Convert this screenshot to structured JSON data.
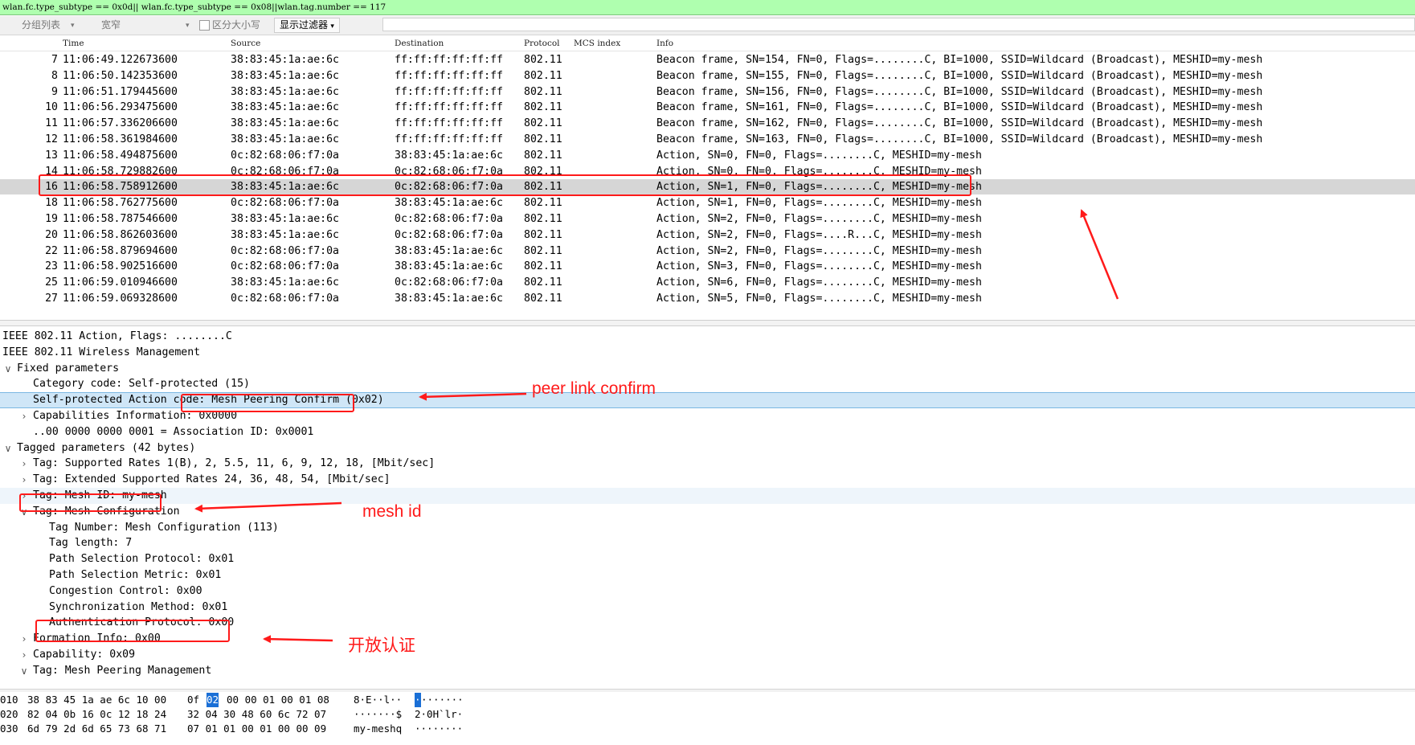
{
  "filter": {
    "text": "wlan.fc.type_subtype == 0x0d|| wlan.fc.type_subtype == 0x08||wlan.tag.number == 117"
  },
  "toolbar": {
    "group_list": "分组列表",
    "width": "宽窄",
    "case_sensitive": "区分大小写",
    "display_filter": "显示过滤器"
  },
  "packet_list": {
    "columns": [
      "Time",
      "Source",
      "Destination",
      "Protocol",
      "MCS index",
      "Info"
    ],
    "rows": [
      {
        "no": "7",
        "time": "11:06:49.122673600",
        "src": "38:83:45:1a:ae:6c",
        "dst": "ff:ff:ff:ff:ff:ff",
        "proto": "802.11",
        "info": "Beacon frame, SN=154, FN=0, Flags=........C, BI=1000, SSID=Wildcard (Broadcast), MESHID=my-mesh"
      },
      {
        "no": "8",
        "time": "11:06:50.142353600",
        "src": "38:83:45:1a:ae:6c",
        "dst": "ff:ff:ff:ff:ff:ff",
        "proto": "802.11",
        "info": "Beacon frame, SN=155, FN=0, Flags=........C, BI=1000, SSID=Wildcard (Broadcast), MESHID=my-mesh"
      },
      {
        "no": "9",
        "time": "11:06:51.179445600",
        "src": "38:83:45:1a:ae:6c",
        "dst": "ff:ff:ff:ff:ff:ff",
        "proto": "802.11",
        "info": "Beacon frame, SN=156, FN=0, Flags=........C, BI=1000, SSID=Wildcard (Broadcast), MESHID=my-mesh"
      },
      {
        "no": "10",
        "time": "11:06:56.293475600",
        "src": "38:83:45:1a:ae:6c",
        "dst": "ff:ff:ff:ff:ff:ff",
        "proto": "802.11",
        "info": "Beacon frame, SN=161, FN=0, Flags=........C, BI=1000, SSID=Wildcard (Broadcast), MESHID=my-mesh"
      },
      {
        "no": "11",
        "time": "11:06:57.336206600",
        "src": "38:83:45:1a:ae:6c",
        "dst": "ff:ff:ff:ff:ff:ff",
        "proto": "802.11",
        "info": "Beacon frame, SN=162, FN=0, Flags=........C, BI=1000, SSID=Wildcard (Broadcast), MESHID=my-mesh"
      },
      {
        "no": "12",
        "time": "11:06:58.361984600",
        "src": "38:83:45:1a:ae:6c",
        "dst": "ff:ff:ff:ff:ff:ff",
        "proto": "802.11",
        "info": "Beacon frame, SN=163, FN=0, Flags=........C, BI=1000, SSID=Wildcard (Broadcast), MESHID=my-mesh"
      },
      {
        "no": "13",
        "time": "11:06:58.494875600",
        "src": "0c:82:68:06:f7:0a",
        "dst": "38:83:45:1a:ae:6c",
        "proto": "802.11",
        "info": "Action, SN=0, FN=0, Flags=........C, MESHID=my-mesh"
      },
      {
        "no": "14",
        "time": "11:06:58.729882600",
        "src": "0c:82:68:06:f7:0a",
        "dst": "0c:82:68:06:f7:0a",
        "proto": "802.11",
        "info": "Action, SN=0, FN=0, Flags=........C, MESHID=my-mesh"
      },
      {
        "no": "16",
        "time": "11:06:58.758912600",
        "src": "38:83:45:1a:ae:6c",
        "dst": "0c:82:68:06:f7:0a",
        "proto": "802.11",
        "info": "Action, SN=1, FN=0, Flags=........C, MESHID=my-mesh"
      },
      {
        "no": "18",
        "time": "11:06:58.762775600",
        "src": "0c:82:68:06:f7:0a",
        "dst": "38:83:45:1a:ae:6c",
        "proto": "802.11",
        "info": "Action, SN=1, FN=0, Flags=........C, MESHID=my-mesh"
      },
      {
        "no": "19",
        "time": "11:06:58.787546600",
        "src": "38:83:45:1a:ae:6c",
        "dst": "0c:82:68:06:f7:0a",
        "proto": "802.11",
        "info": "Action, SN=2, FN=0, Flags=........C, MESHID=my-mesh"
      },
      {
        "no": "20",
        "time": "11:06:58.862603600",
        "src": "38:83:45:1a:ae:6c",
        "dst": "0c:82:68:06:f7:0a",
        "proto": "802.11",
        "info": "Action, SN=2, FN=0, Flags=....R...C, MESHID=my-mesh"
      },
      {
        "no": "22",
        "time": "11:06:58.879694600",
        "src": "0c:82:68:06:f7:0a",
        "dst": "38:83:45:1a:ae:6c",
        "proto": "802.11",
        "info": "Action, SN=2, FN=0, Flags=........C, MESHID=my-mesh"
      },
      {
        "no": "23",
        "time": "11:06:58.902516600",
        "src": "0c:82:68:06:f7:0a",
        "dst": "38:83:45:1a:ae:6c",
        "proto": "802.11",
        "info": "Action, SN=3, FN=0, Flags=........C, MESHID=my-mesh"
      },
      {
        "no": "25",
        "time": "11:06:59.010946600",
        "src": "38:83:45:1a:ae:6c",
        "dst": "0c:82:68:06:f7:0a",
        "proto": "802.11",
        "info": "Action, SN=6, FN=0, Flags=........C, MESHID=my-mesh"
      },
      {
        "no": "27",
        "time": "11:06:59.069328600",
        "src": "0c:82:68:06:f7:0a",
        "dst": "38:83:45:1a:ae:6c",
        "proto": "802.11",
        "info": "Action, SN=5, FN=0, Flags=........C, MESHID=my-mesh"
      }
    ]
  },
  "details": {
    "rows": [
      {
        "toggle": "",
        "text": "IEEE 802.11 Action, Flags: ........C"
      },
      {
        "toggle": "",
        "text": "IEEE 802.11 Wireless Management"
      },
      {
        "toggle": "∨",
        "text": "Fixed parameters"
      },
      {
        "toggle": "",
        "text": "Category code: Self-protected (15)"
      },
      {
        "toggle": "",
        "text": "Self-protected Action code: Mesh Peering Confirm (0x02)"
      },
      {
        "toggle": "›",
        "text": "Capabilities Information: 0x0000"
      },
      {
        "toggle": "",
        "text": "..00 0000 0000 0001 = Association ID: 0x0001"
      },
      {
        "toggle": "∨",
        "text": "Tagged parameters (42 bytes)"
      },
      {
        "toggle": "›",
        "text": "Tag: Supported Rates 1(B), 2, 5.5, 11, 6, 9, 12, 18, [Mbit/sec]"
      },
      {
        "toggle": "›",
        "text": "Tag: Extended Supported Rates 24, 36, 48, 54, [Mbit/sec]"
      },
      {
        "toggle": "›",
        "text": "Tag: Mesh ID: my-mesh"
      },
      {
        "toggle": "∨",
        "text": "Tag: Mesh Configuration"
      },
      {
        "toggle": "",
        "text": "Tag Number: Mesh Configuration (113)"
      },
      {
        "toggle": "",
        "text": "Tag length: 7"
      },
      {
        "toggle": "",
        "text": "Path Selection Protocol: 0x01"
      },
      {
        "toggle": "",
        "text": "Path Selection Metric: 0x01"
      },
      {
        "toggle": "",
        "text": "Congestion Control: 0x00"
      },
      {
        "toggle": "",
        "text": "Synchronization Method: 0x01"
      },
      {
        "toggle": "",
        "text": "Authentication Protocol: 0x00"
      },
      {
        "toggle": "›",
        "text": "Formation Info: 0x00"
      },
      {
        "toggle": "›",
        "text": "Capability: 0x09"
      },
      {
        "toggle": "∨",
        "text": "Tag: Mesh Peering Management"
      }
    ]
  },
  "bytes": {
    "rows": [
      {
        "offset": "010",
        "hex_a": "38 83 45 1a ae 6c 10 00",
        "hex_b1": "0f",
        "hex_sel": "02",
        "hex_b2": "00 00 01 00 01 08",
        "ascii_a": "8·E··l··",
        "ascii_sel": "·",
        "ascii_b": "·······"
      },
      {
        "offset": "020",
        "hex_a": "82 04 0b 16 0c 12 18 24",
        "hex_b1": "32 04 30 48 60 6c 72 07",
        "hex_sel": "",
        "hex_b2": "",
        "ascii_a": "·······$",
        "ascii_sel": "",
        "ascii_b": "2·0H`lr·"
      },
      {
        "offset": "030",
        "hex_a": "6d 79 2d 6d 65 73 68 71",
        "hex_b1": "07 01 01 00 01 00 00 09",
        "hex_sel": "",
        "hex_b2": "",
        "ascii_a": "my-meshq",
        "ascii_sel": "",
        "ascii_b": "········"
      }
    ]
  },
  "annotations": {
    "peer_link": "peer link confirm",
    "mesh_id": "mesh id",
    "open_auth": "开放认证"
  },
  "colors": {
    "annotation": "#ff1a1a",
    "filter_bg": "#afffaf",
    "selected_row": "#d6d6d6",
    "detail_highlight": "#cfe6f7"
  }
}
